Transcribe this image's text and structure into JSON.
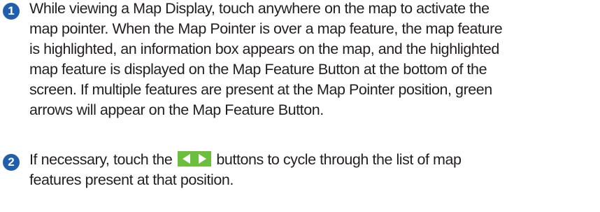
{
  "colors": {
    "step_badge": "#1f5fad",
    "arrow_button_bg": "#6bbf3c",
    "arrow_fill": "#ffffff"
  },
  "steps": [
    {
      "number": "1",
      "lines": [
        "While viewing a Map Display, touch anywhere on the map to activate the",
        "map pointer.  When the Map Pointer is over a map feature, the map feature",
        "is highlighted, an information box appears on the map, and the highlighted",
        "map feature is displayed on the Map Feature Button at the bottom of the",
        "screen.  If multiple features are present at the Map Pointer position, green",
        "arrows will appear on the Map Feature Button."
      ]
    },
    {
      "number": "2",
      "text_before_icon": "If necessary, touch the ",
      "icon": "green-left-right-arrows-icon",
      "text_after_icon": " buttons to cycle through the list of map",
      "line2": "features present at that position."
    }
  ]
}
